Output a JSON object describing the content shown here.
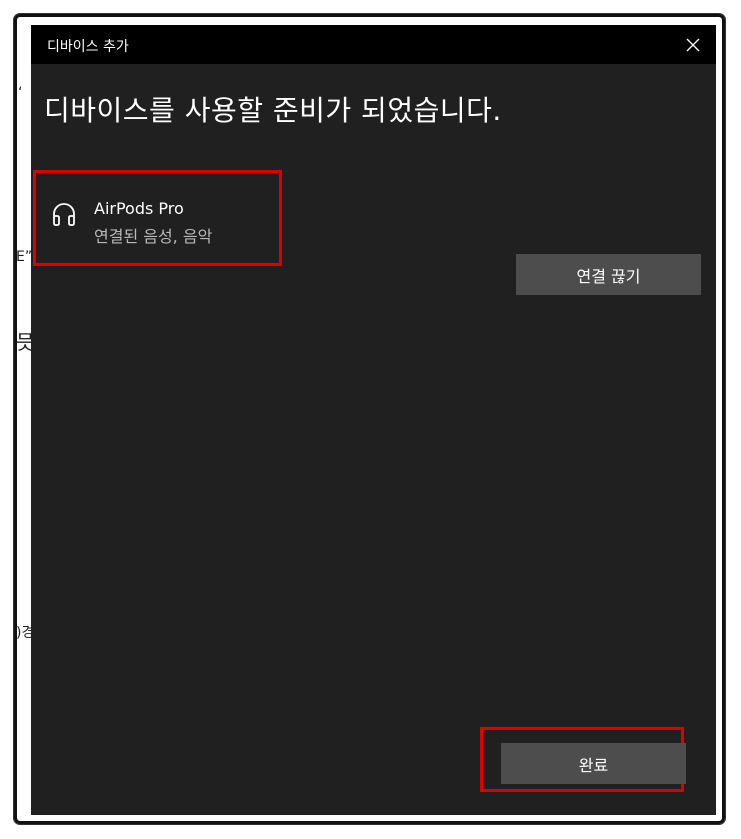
{
  "window": {
    "title": "디바이스 추가",
    "close_label": "×"
  },
  "main": {
    "heading": "디바이스를 사용할 준비가 되었습니다.",
    "device": {
      "name": "AirPods Pro",
      "status": "연결된 음성, 음악",
      "icon": "headphones-icon"
    },
    "disconnect_label": "연결 끊기",
    "done_label": "완료"
  },
  "colors": {
    "dialog_bg": "#202020",
    "titlebar_bg": "#000000",
    "button_bg": "#4d4d4d",
    "highlight": "#e00000"
  }
}
